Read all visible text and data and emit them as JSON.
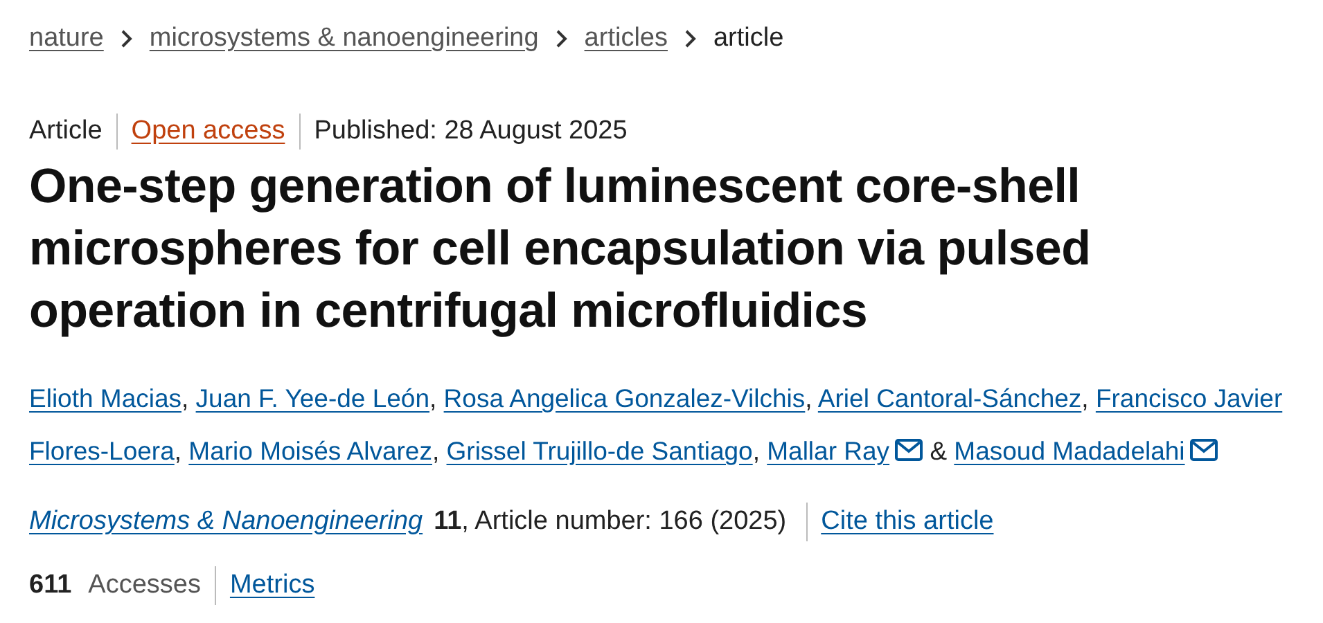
{
  "breadcrumbs": [
    {
      "label": "nature",
      "current": false
    },
    {
      "label": "microsystems & nanoengineering",
      "current": false
    },
    {
      "label": "articles",
      "current": false
    },
    {
      "label": "article",
      "current": true
    }
  ],
  "meta": {
    "type": "Article",
    "access": "Open access",
    "published": "Published: 28 August 2025"
  },
  "title": "One-step generation of luminescent core-shell microspheres for cell encapsulation via pulsed operation in centrifugal microfluidics",
  "authors": [
    {
      "kind": "author",
      "name": "Elioth Macias",
      "separator": ",",
      "email": false
    },
    {
      "kind": "author",
      "name": "Juan F. Yee-de León",
      "separator": ",",
      "email": false
    },
    {
      "kind": "author",
      "name": "Rosa Angelica Gonzalez-Vilchis",
      "separator": ",",
      "email": false
    },
    {
      "kind": "author",
      "name": "Ariel Cantoral-Sánchez",
      "separator": ",",
      "email": false
    },
    {
      "kind": "author_wrapped",
      "name_lines": [
        "Francisco Javier",
        "Flores-Loera"
      ],
      "separator": ",",
      "email": false
    },
    {
      "kind": "author",
      "name": "Mario Moisés Alvarez",
      "separator": ",",
      "email": false
    },
    {
      "kind": "author",
      "name": "Grissel Trujillo-de Santiago",
      "separator": ",",
      "email": false
    },
    {
      "kind": "author",
      "name": "Mallar Ray",
      "email": true
    },
    {
      "kind": "conjunction",
      "text": "&"
    },
    {
      "kind": "author",
      "name": "Masoud Madadelahi",
      "email": true
    }
  ],
  "citation": {
    "journal": "Microsystems & Nanoengineering",
    "volume": "11",
    "details": ", Article number: 166 (2025)",
    "cite_link": "Cite this article"
  },
  "metrics": {
    "count": "611",
    "label": "Accesses",
    "link": "Metrics"
  }
}
